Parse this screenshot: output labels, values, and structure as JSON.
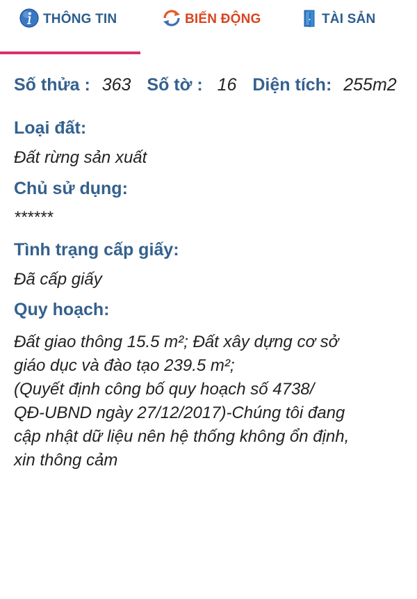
{
  "tabs": [
    {
      "label": "THÔNG TIN",
      "icon": "info-icon"
    },
    {
      "label": "BIẾN ĐỘNG",
      "icon": "refresh-icon"
    },
    {
      "label": "TÀI SẢN",
      "icon": "door-icon"
    }
  ],
  "active_tab": "THÔNG TIN",
  "parcel": {
    "so_thua_label": "Số thửa :",
    "so_thua_value": "363",
    "so_to_label": "Số tờ :",
    "so_to_value": "16",
    "dien_tich_label": "Diện tích:",
    "dien_tich_value": "255m2"
  },
  "sections": {
    "loai_dat": {
      "label": "Loại đất:",
      "value": "Đất rừng sản xuất"
    },
    "chu_su_dung": {
      "label": "Chủ sử dụng:",
      "value": "******"
    },
    "tinh_trang": {
      "label": "Tình trạng cấp giấy:",
      "value": "Đã cấp giấy"
    },
    "quy_hoach": {
      "label": "Quy hoạch:",
      "lines": [
        "Đất giao thông 15.5 m²; Đất xây dựng cơ sở",
        "giáo dục và đào tạo 239.5 m²;",
        "(Quyết định công bố quy hoạch số 4738/",
        "QĐ-UBND ngày 27/12/2017)-Chúng tôi đang",
        "cập nhật dữ liệu nên hệ thống không ổn định,",
        "xin thông cảm"
      ]
    }
  },
  "colors": {
    "label_blue": "#34618e",
    "tab_blue": "#2c5d8e",
    "tab_orange": "#d9451f",
    "active_indicator": "#d6336c",
    "body_text": "#222222"
  }
}
